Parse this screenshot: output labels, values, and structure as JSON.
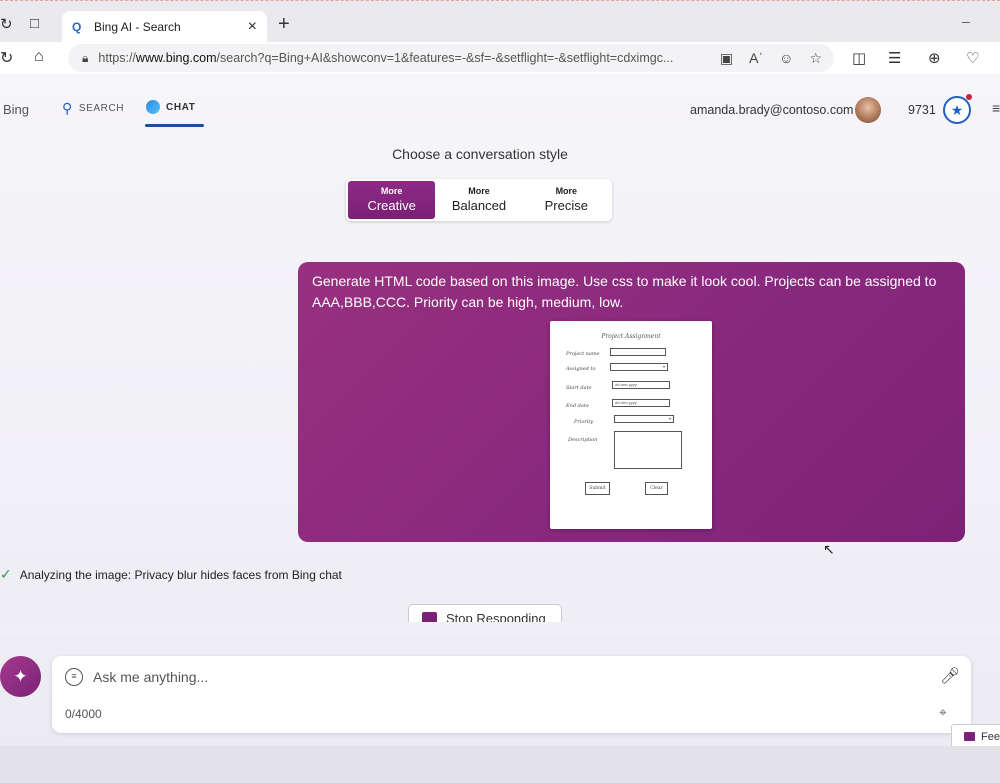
{
  "browser": {
    "tab_title": "Bing AI - Search",
    "url_prefix": "https://",
    "url_domain": "www.bing.com",
    "url_rest": "/search?q=Bing+AI&showconv=1&features=-&sf=-&setflight=-&setflight=cdximgc..."
  },
  "header": {
    "brand": "Bing",
    "search_label": "SEARCH",
    "chat_label": "CHAT",
    "user_email": "amanda.brady@contoso.com",
    "points": "9731"
  },
  "style_picker": {
    "heading": "Choose a conversation style",
    "options": [
      {
        "small": "More",
        "big": "Creative",
        "active": true
      },
      {
        "small": "More",
        "big": "Balanced",
        "active": false
      },
      {
        "small": "More",
        "big": "Precise",
        "active": false
      }
    ]
  },
  "user_message": {
    "text": "Generate HTML code based on this image. Use css to make it look cool. Projects can be assigned to AAA,BBB,CCC. Priority can be high, medium, low.",
    "sketch": {
      "title": "Project Assignment",
      "labels": [
        "Project name",
        "Assigned to",
        "Start date",
        "End date",
        "Priority",
        "Description"
      ],
      "start_date": "dd-mm-yyyy",
      "end_date": "dd-mm-yyyy",
      "submit": "Submit",
      "clear": "Clear"
    }
  },
  "status": {
    "text": "Analyzing the image: Privacy blur hides faces from Bing chat"
  },
  "stop_button": {
    "label": "Stop Responding"
  },
  "input": {
    "placeholder": "Ask me anything...",
    "counter": "0/4000"
  },
  "feedback": {
    "label": "Fee"
  },
  "colors": {
    "accent": "#7b2278",
    "chat_blue": "#1b4f9a"
  }
}
